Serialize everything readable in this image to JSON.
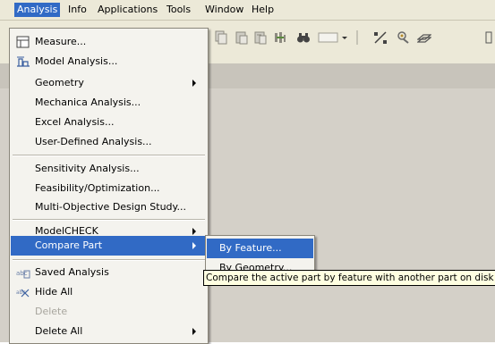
{
  "menubar": {
    "items": [
      {
        "label": "Analysis"
      },
      {
        "label": "Info"
      },
      {
        "label": "Applications"
      },
      {
        "label": "Tools"
      },
      {
        "label": "Window"
      },
      {
        "label": "Help"
      }
    ],
    "active_index": 0
  },
  "toolbar": {
    "icons": [
      "copy-icon",
      "paste-icon",
      "paste-special-icon",
      "regenerate-icon",
      "find-icon",
      "selection-filter-dropdown",
      "datum-icon",
      "model-tree-icon",
      "layers-icon"
    ]
  },
  "analysis_menu": {
    "items": [
      {
        "label": "Measure...",
        "icon": "measure-icon"
      },
      {
        "label": "Model Analysis...",
        "icon": "model-analysis-icon"
      },
      {
        "label": "Geometry",
        "submenu": true
      },
      {
        "label": "Mechanica Analysis..."
      },
      {
        "label": "Excel Analysis..."
      },
      {
        "label": "User-Defined Analysis..."
      },
      {
        "label": "Sensitivity Analysis..."
      },
      {
        "label": "Feasibility/Optimization..."
      },
      {
        "label": "Multi-Objective Design Study..."
      },
      {
        "label": "ModelCHECK",
        "submenu": true
      },
      {
        "label": "Compare Part",
        "submenu": true,
        "highlighted": true
      },
      {
        "label": "Saved Analysis",
        "icon": "saved-analysis-icon"
      },
      {
        "label": "Hide All",
        "icon": "hide-all-icon"
      },
      {
        "label": "Delete",
        "disabled": true
      },
      {
        "label": "Delete All",
        "submenu": true
      }
    ]
  },
  "compare_part_submenu": {
    "items": [
      {
        "label": "By Feature...",
        "highlighted": true
      },
      {
        "label": "By Geometry..."
      }
    ]
  },
  "tooltip": {
    "text": "Compare the active part by feature with another part on disk"
  },
  "colors": {
    "highlight": "#316ac5",
    "menubar_bg": "#ece9d8",
    "menu_bg": "#f4f3ee",
    "workspace_bg": "#d4d0c8",
    "tooltip_bg": "#ffffe1",
    "disabled_text": "#a7a59d"
  }
}
